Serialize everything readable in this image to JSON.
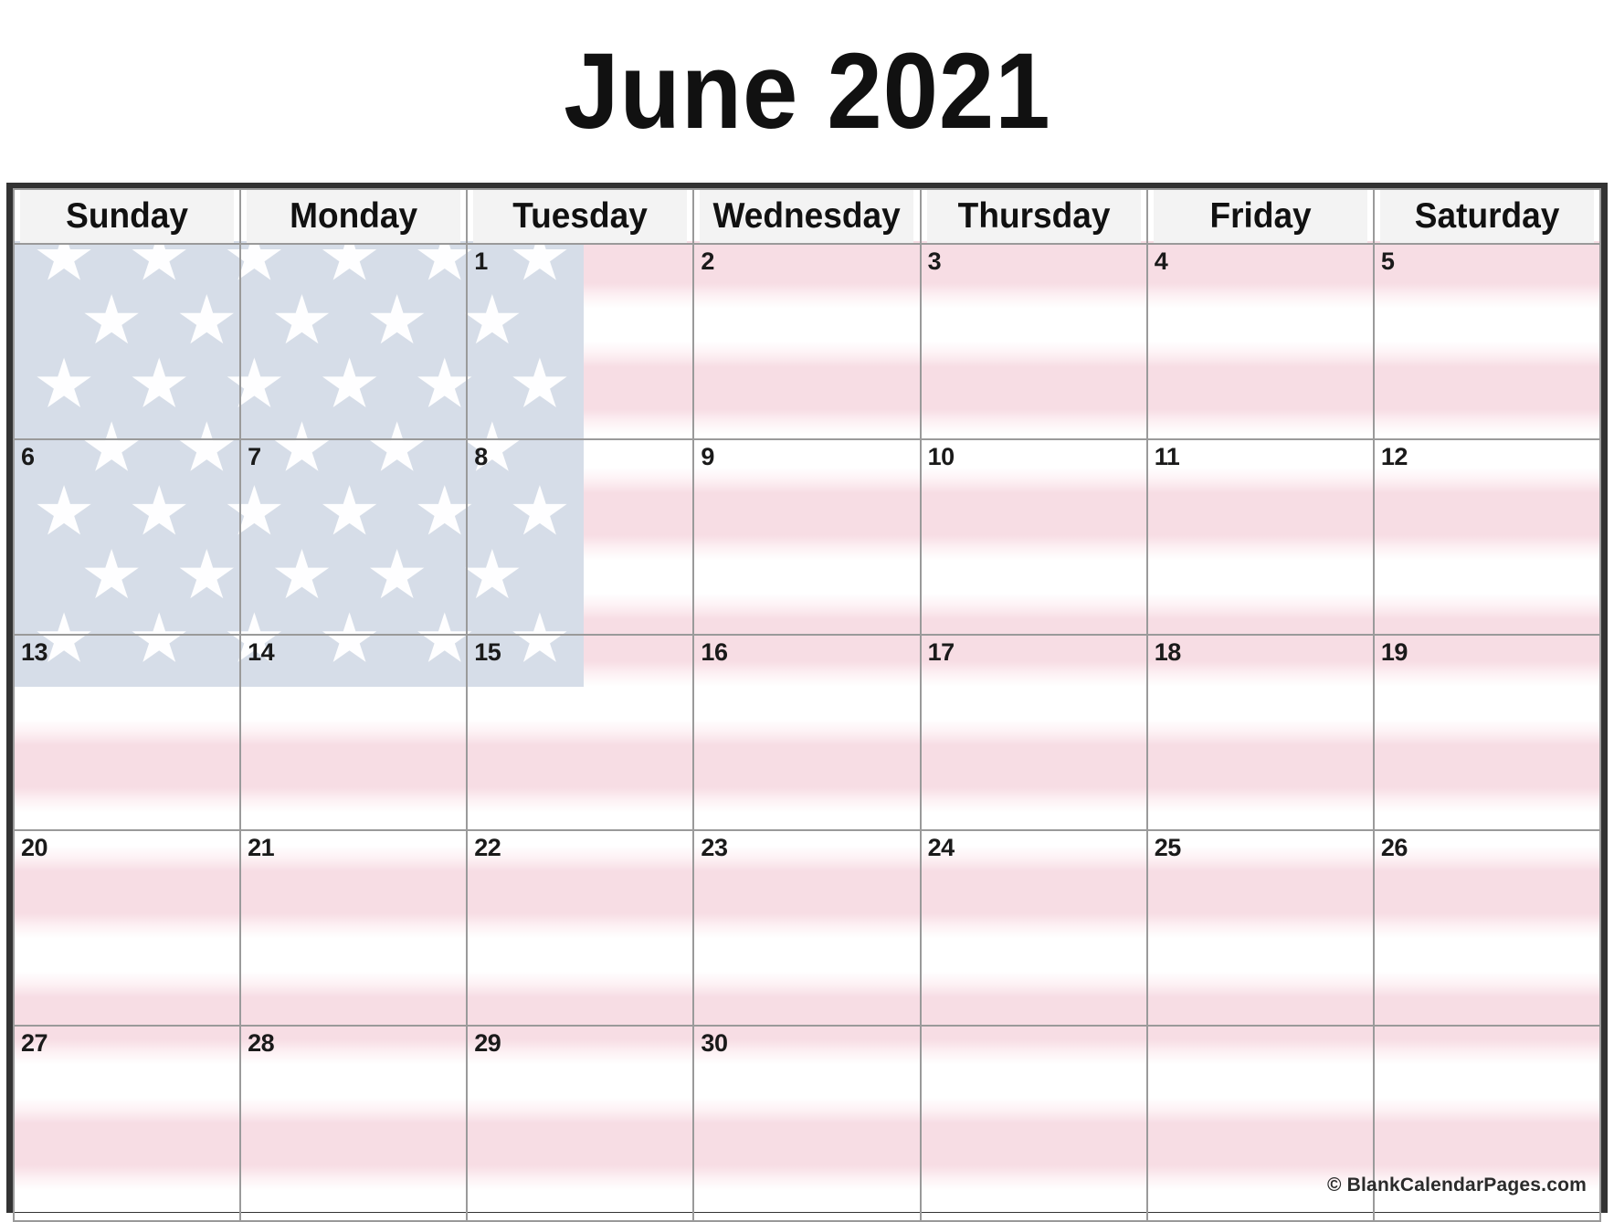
{
  "page": {
    "title": "June 2021",
    "month": "June",
    "year": "2021"
  },
  "weekdays": [
    {
      "label": "Sunday"
    },
    {
      "label": "Monday"
    },
    {
      "label": "Tuesday"
    },
    {
      "label": "Wednesday"
    },
    {
      "label": "Thursday"
    },
    {
      "label": "Friday"
    },
    {
      "label": "Saturday"
    }
  ],
  "weeks": [
    [
      {
        "day": "",
        "empty": true
      },
      {
        "day": "",
        "empty": true
      },
      {
        "day": "1",
        "empty": false
      },
      {
        "day": "2",
        "empty": false
      },
      {
        "day": "3",
        "empty": false
      },
      {
        "day": "4",
        "empty": false
      },
      {
        "day": "5",
        "empty": false
      }
    ],
    [
      {
        "day": "6",
        "empty": false
      },
      {
        "day": "7",
        "empty": false
      },
      {
        "day": "8",
        "empty": false
      },
      {
        "day": "9",
        "empty": false
      },
      {
        "day": "10",
        "empty": false
      },
      {
        "day": "11",
        "empty": false
      },
      {
        "day": "12",
        "empty": false
      }
    ],
    [
      {
        "day": "13",
        "empty": false
      },
      {
        "day": "14",
        "empty": false
      },
      {
        "day": "15",
        "empty": false
      },
      {
        "day": "16",
        "empty": false
      },
      {
        "day": "17",
        "empty": false
      },
      {
        "day": "18",
        "empty": false
      },
      {
        "day": "19",
        "empty": false
      }
    ],
    [
      {
        "day": "20",
        "empty": false
      },
      {
        "day": "21",
        "empty": false
      },
      {
        "day": "22",
        "empty": false
      },
      {
        "day": "23",
        "empty": false
      },
      {
        "day": "24",
        "empty": false
      },
      {
        "day": "25",
        "empty": false
      },
      {
        "day": "26",
        "empty": false
      }
    ],
    [
      {
        "day": "27",
        "empty": false
      },
      {
        "day": "28",
        "empty": false
      },
      {
        "day": "29",
        "empty": false
      },
      {
        "day": "30",
        "empty": false
      },
      {
        "day": "",
        "empty": true
      },
      {
        "day": "",
        "empty": true
      },
      {
        "day": "",
        "empty": true
      }
    ]
  ],
  "footer": {
    "credit": "© BlankCalendarPages.com"
  },
  "theme": {
    "flag_canton": "#d6dde8",
    "flag_stripe_pink": "#f7dde4",
    "flag_stripe_white": "#ffffff",
    "header_bg": "#f3f3f3",
    "grid_border": "#9a9a9a",
    "outer_border": "#333333",
    "text": "#111111",
    "star_color": "#ffffff"
  },
  "stars": {
    "rows": 7,
    "cols_long": 6,
    "cols_short": 5
  }
}
